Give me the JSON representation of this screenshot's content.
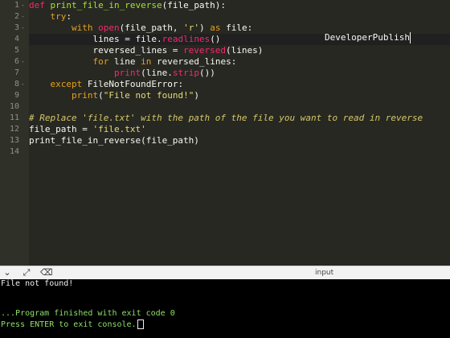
{
  "editor": {
    "line_numbers": [
      "1",
      "2",
      "3",
      "4",
      "5",
      "6",
      "7",
      "8",
      "9",
      "10",
      "11",
      "12",
      "13",
      "14"
    ],
    "lines": [
      [
        {
          "t": "def ",
          "c": "kw"
        },
        {
          "t": "print_file_in_reverse",
          "c": "fn"
        },
        {
          "t": "(file_path):",
          "c": ""
        }
      ],
      [
        {
          "t": "    ",
          "c": ""
        },
        {
          "t": "try",
          "c": "kwo"
        },
        {
          "t": ":",
          "c": ""
        }
      ],
      [
        {
          "t": "        ",
          "c": ""
        },
        {
          "t": "with ",
          "c": "kwo"
        },
        {
          "t": "open",
          "c": "bi"
        },
        {
          "t": "(file_path, ",
          "c": ""
        },
        {
          "t": "'r'",
          "c": "st"
        },
        {
          "t": ") ",
          "c": ""
        },
        {
          "t": "as ",
          "c": "kwo"
        },
        {
          "t": "file:",
          "c": ""
        }
      ],
      [
        {
          "t": "            lines = file.",
          "c": ""
        },
        {
          "t": "readlines",
          "c": "bi"
        },
        {
          "t": "()",
          "c": ""
        }
      ],
      [
        {
          "t": "            reversed_lines = ",
          "c": ""
        },
        {
          "t": "reversed",
          "c": "bi"
        },
        {
          "t": "(lines)",
          "c": ""
        }
      ],
      [
        {
          "t": "            ",
          "c": ""
        },
        {
          "t": "for ",
          "c": "kwo"
        },
        {
          "t": "line ",
          "c": ""
        },
        {
          "t": "in ",
          "c": "kwo"
        },
        {
          "t": "reversed_lines:",
          "c": ""
        }
      ],
      [
        {
          "t": "                ",
          "c": ""
        },
        {
          "t": "print",
          "c": "bi"
        },
        {
          "t": "(line.",
          "c": ""
        },
        {
          "t": "strip",
          "c": "bi"
        },
        {
          "t": "())",
          "c": ""
        }
      ],
      [
        {
          "t": "    ",
          "c": ""
        },
        {
          "t": "except ",
          "c": "kwo"
        },
        {
          "t": "FileNotFoundError:",
          "c": ""
        }
      ],
      [
        {
          "t": "        ",
          "c": ""
        },
        {
          "t": "print",
          "c": "kwo"
        },
        {
          "t": "(",
          "c": ""
        },
        {
          "t": "\"File not found!\"",
          "c": "st"
        },
        {
          "t": ")",
          "c": ""
        }
      ],
      [],
      [
        {
          "t": "# Replace 'file.txt' with the path of the file you want to read in reverse",
          "c": "cm"
        }
      ],
      [
        {
          "t": "file_path = ",
          "c": ""
        },
        {
          "t": "'file.txt'",
          "c": "st"
        }
      ],
      [
        {
          "t": "print_file_in_reverse(file_path)",
          "c": ""
        }
      ],
      []
    ],
    "watermark": "DeveloperPublish"
  },
  "toolbar": {
    "collapse_icon": "chevron-down-icon",
    "expand_icon": "expand-arrows-icon",
    "clear_icon": "clear-console-icon",
    "tab_label": "input"
  },
  "console": {
    "lines": [
      "File not found!",
      "",
      "",
      "...Program finished with exit code 0",
      "Press ENTER to exit console."
    ]
  }
}
